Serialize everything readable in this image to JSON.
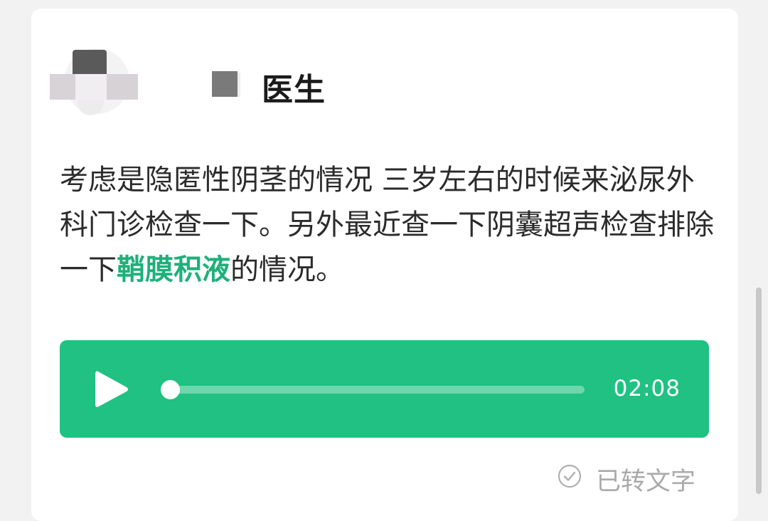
{
  "doctor": {
    "name": "医生",
    "avatar": "blurred-avatar"
  },
  "message": {
    "before": "考虑是隐匿性阴茎的情况 三岁左右的时候来泌尿外科门诊检查一下。另外最近查一下阴囊超声检查排除一下",
    "highlight": "鞘膜积液",
    "after": "的情况。"
  },
  "audio": {
    "duration": "02:08",
    "progress": 0
  },
  "transcribed": {
    "label": "已转文字",
    "icon": "check-circle-icon"
  },
  "colors": {
    "accent": "#20c182",
    "highlight": "#1fb07a"
  }
}
